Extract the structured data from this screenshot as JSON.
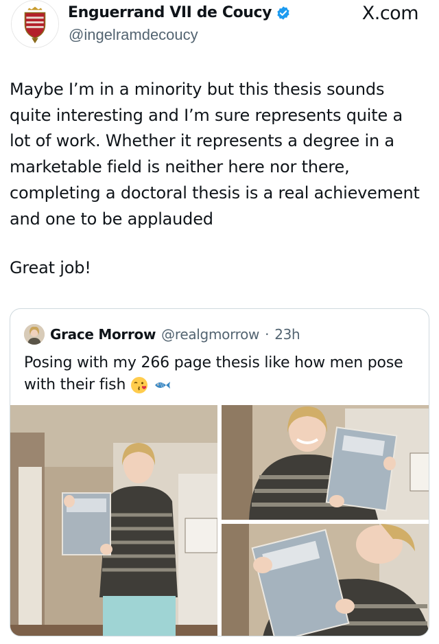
{
  "tweet": {
    "author": {
      "display_name": "Enguerrand VII de Coucy",
      "handle": "@ingelramdecoucy",
      "verified": true,
      "avatar_icon": "heraldic-shield-icon"
    },
    "brand": "X.com",
    "body_paragraph": "Maybe I’m in a minority but this thesis sounds quite interesting and I’m sure represents quite a lot of work. Whether it represents a degree in a marketable field is neither here nor there, completing a doctoral thesis is a real achievement and one to be applauded",
    "closing": "Great job!"
  },
  "quoted_tweet": {
    "display_name": "Grace Morrow",
    "handle": "@realgmorrow",
    "separator": "·",
    "time": "23h",
    "text": "Posing with my 266 page thesis like how men pose with their fish",
    "emojis": [
      "kissing-face-emoji",
      "fish-emoji"
    ],
    "photos": [
      {
        "name": "photo-holding-thesis-full"
      },
      {
        "name": "photo-holding-thesis-closeup"
      },
      {
        "name": "photo-kissing-thesis"
      }
    ]
  },
  "colors": {
    "text": "#0f1419",
    "secondary": "#536471",
    "verified_blue": "#1d9bf0",
    "border": "#cfd9de"
  }
}
